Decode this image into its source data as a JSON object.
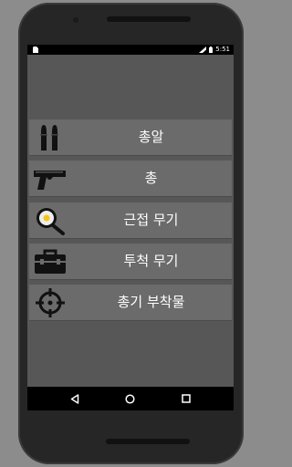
{
  "status_bar": {
    "time": "5:51",
    "icons": [
      "sim-card-icon",
      "signal-icon",
      "battery-icon"
    ]
  },
  "menu": {
    "items": [
      {
        "label": "총알",
        "icon": "bullets-icon"
      },
      {
        "label": "총",
        "icon": "pistol-icon"
      },
      {
        "label": "근접 무기",
        "icon": "frying-pan-icon"
      },
      {
        "label": "투척 무기",
        "icon": "toolbox-icon"
      },
      {
        "label": "총기 부착물",
        "icon": "crosshair-icon"
      }
    ]
  },
  "nav_bar": {
    "buttons": [
      "back-icon",
      "home-icon",
      "recents-icon"
    ]
  },
  "colors": {
    "screen_bg": "#575757",
    "item_bg": "#6b6b6b",
    "item_text": "#ffffff",
    "bars": "#000000",
    "pan_yellow": "#f5c518"
  }
}
